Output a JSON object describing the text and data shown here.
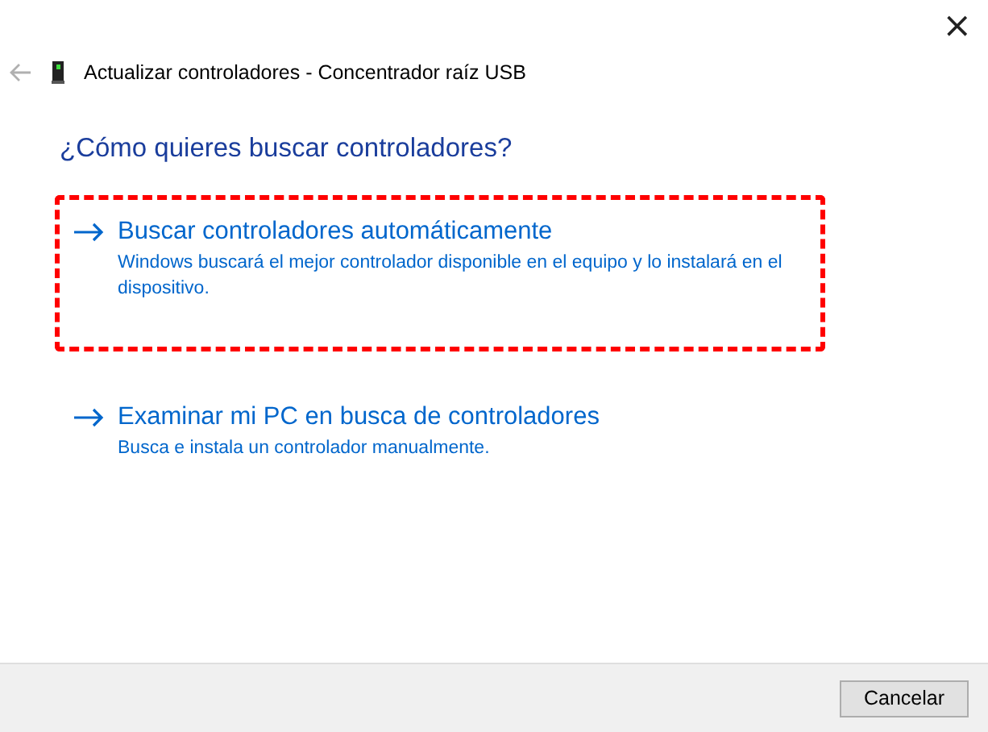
{
  "window": {
    "title": "Actualizar controladores - Concentrador raíz USB",
    "close": "×"
  },
  "question": "¿Cómo quieres buscar controladores?",
  "options": [
    {
      "title": "Buscar controladores automáticamente",
      "description": "Windows buscará el mejor controlador disponible en el equipo y lo instalará en el dispositivo.",
      "highlighted": true
    },
    {
      "title": "Examinar mi PC en busca de controladores",
      "description": "Busca e instala un controlador manualmente.",
      "highlighted": false
    }
  ],
  "buttons": [
    "Cancelar"
  ]
}
